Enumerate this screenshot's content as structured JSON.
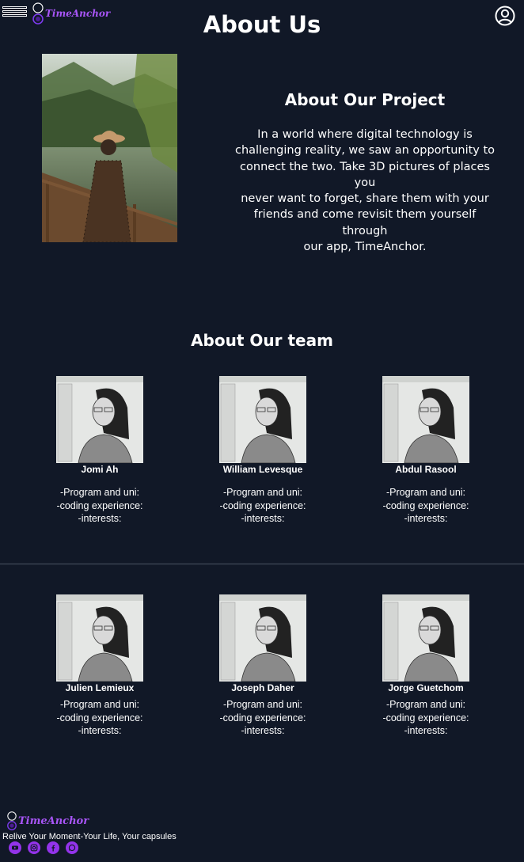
{
  "header": {
    "brand": "TimeAnchor",
    "page_title": "About Us"
  },
  "project": {
    "title": "About Our Project",
    "text_lines": [
      "In a world where digital technology is",
      "challenging reality, we saw an opportunity to",
      "connect the two. Take 3D pictures of places you",
      "never want to forget, share them with your",
      "friends and come revisit them yourself through",
      "our app, TimeAnchor."
    ]
  },
  "team": {
    "title": "About Our team",
    "members": [
      {
        "name": "Jomi Ah",
        "program": "-Program and uni:",
        "coding": "-coding experience:",
        "interests": "-interests:"
      },
      {
        "name": "William Levesque",
        "program": "-Program and uni:",
        "coding": "-coding experience:",
        "interests": "-interests:"
      },
      {
        "name": "Abdul Rasool",
        "program": "-Program and uni:",
        "coding": "-coding experience:",
        "interests": "-interests:"
      },
      {
        "name": "Julien Lemieux",
        "program": "-Program and uni:",
        "coding": "-coding experience:",
        "interests": "-interests:"
      },
      {
        "name": "Joseph Daher",
        "program": "-Program and uni:",
        "coding": "-coding experience:",
        "interests": "-interests:"
      },
      {
        "name": "Jorge Guetchom",
        "program": "-Program and uni:",
        "coding": "-coding experience:",
        "interests": "-interests:"
      }
    ]
  },
  "footer": {
    "brand": "TimeAnchor",
    "tagline": "Relive Your Moment-Your Life, Your capsules",
    "socials": [
      "youtube-icon",
      "instagram-icon",
      "facebook-icon",
      "whatsapp-icon"
    ]
  },
  "colors": {
    "background": "#111827",
    "accent": "#a855f7",
    "social_bg": "#9333ea"
  }
}
